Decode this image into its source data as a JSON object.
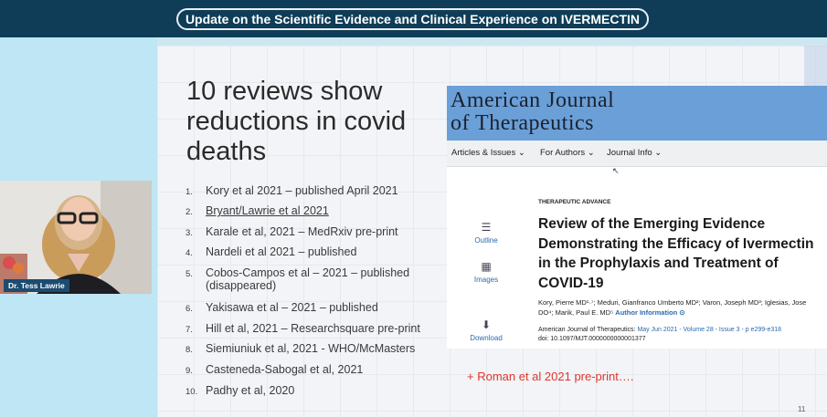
{
  "banner": {
    "title": "Update on the Scientific Evidence and Clinical Experience on IVERMECTIN"
  },
  "slide": {
    "headline": "10 reviews show reductions in covid deaths",
    "items": [
      {
        "num": "1.",
        "text": "Kory et al 2021 – published April 2021"
      },
      {
        "num": "2.",
        "text": "Bryant/Lawrie et al 2021"
      },
      {
        "num": "3.",
        "text": "Karale et al, 2021 – MedRxiv pre-print"
      },
      {
        "num": "4.",
        "text": "Nardeli et al 2021 – published"
      },
      {
        "num": "5.",
        "text": "Cobos-Campos et al – 2021 – published (disappeared)"
      },
      {
        "num": "6.",
        "text": "Yakisawa et al – 2021 – published"
      },
      {
        "num": "7.",
        "text": "Hill et al, 2021 – Researchsquare pre-print"
      },
      {
        "num": "8.",
        "text": "Siemiuniuk et al, 2021 - WHO/McMasters"
      },
      {
        "num": "9.",
        "text": "Casteneda-Sabogal et al, 2021"
      },
      {
        "num": "10.",
        "text": "Padhy et al, 2020"
      }
    ],
    "footnote": "+ Roman et al 2021 pre-print….",
    "page_number": "11"
  },
  "journal": {
    "name_line1": "American Journal",
    "name_line2": "of Therapeutics",
    "nav": [
      "Articles & Issues ⌄",
      "For Authors ⌄",
      "Journal Info ⌄"
    ],
    "side": [
      {
        "icon": "☰",
        "label": "Outline",
        "icon_name": "outline-icon"
      },
      {
        "icon": "▦",
        "label": "Images",
        "icon_name": "images-icon"
      },
      {
        "icon": "⬇",
        "label": "Download",
        "icon_name": "download-icon"
      }
    ],
    "eyebrow": "THERAPEUTIC ADVANCE",
    "article_title": "Review of the Emerging Evidence Demonstrating the Efficacy of Ivermectin in the Prophylaxis and Treatment of COVID-19",
    "authors_text": "Kory, Pierre MD¹·⁷; Meduri, Gianfranco Umberto MD²; Varon, Joseph MD³; Iglesias, Jose DO⁴; Marik, Paul E. MD⁵",
    "author_info": "Author Information ⊙",
    "journal_ref": "American Journal of Therapeutics:",
    "journal_ref_link": "May Jun 2021 - Volume 28 - Issue 3 - p e299-e318",
    "doi": "doi: 10.1097/MJT.0000000000001377"
  },
  "speaker": {
    "name": "Dr. Tess Lawrie"
  }
}
